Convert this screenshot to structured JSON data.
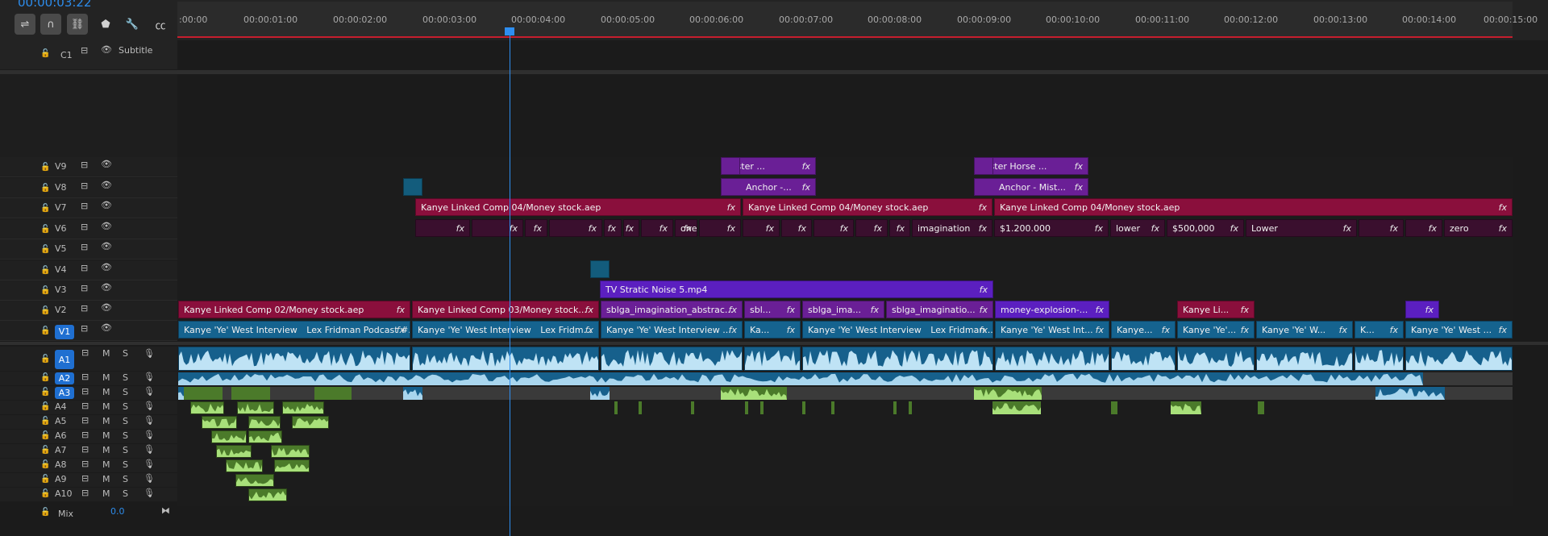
{
  "timecode": "00:00:03:22",
  "ruler_ticks": [
    ":00:00",
    "00:00:01:00",
    "00:00:02:00",
    "00:00:03:00",
    "00:00:04:00",
    "00:00:05:00",
    "00:00:06:00",
    "00:00:07:00",
    "00:00:08:00",
    "00:00:09:00",
    "00:00:10:00",
    "00:00:11:00",
    "00:00:12:00",
    "00:00:13:00",
    "00:00:14:00",
    "00:00:15:00"
  ],
  "caption_track": {
    "name": "C1",
    "label": "Subtitle"
  },
  "video_tracks": [
    "V9",
    "V8",
    "V7",
    "V6",
    "V5",
    "V4",
    "V3",
    "V2",
    "V1"
  ],
  "audio_tracks": [
    "A1",
    "A2",
    "A3",
    "A4",
    "A5",
    "A6",
    "A7",
    "A8",
    "A9",
    "A10"
  ],
  "mix": {
    "label": "Mix",
    "value": "0.0"
  },
  "audio_buttons": {
    "mute": "M",
    "solo": "S"
  },
  "fx": "fx",
  "clips": {
    "v9_a": "Mister ...",
    "v9_b": "Mister Horse ...",
    "v8_a": "Anchor -...",
    "v8_b": "Anchor - Mist...",
    "v7_a": "Kanye Linked Comp 04/Money stock.aep",
    "v7_b": "Kanye Linked Comp 04/Money stock.aep",
    "v7_c": "Kanye Linked Comp 04/Money stock.aep",
    "v6_one": "one",
    "v6_imagination": "imagination",
    "v6_1200000": "$1.200.000",
    "v6_lower1": "lower",
    "v6_500000": "$500,000",
    "v6_lower2": "Lower",
    "v6_zero": "zero",
    "v3_a": "TV Stratic Noise 5.mp4",
    "v2_a": "Kanye Linked Comp 02/Money stock.aep",
    "v2_b": "Kanye Linked Comp 03/Money stock...",
    "v2_c": "sblga_imagination_abstrac...",
    "v2_d": "sbl...",
    "v2_e": "sblga_ima...",
    "v2_f": "sblga_imaginatio...",
    "v2_g": "money-explosion-...",
    "v2_h": "Kanye Li...",
    "v1_a": "Kanye 'Ye' West Interview",
    "v1_a2": "Lex Fridman Podcast #...",
    "v1_b": "Kanye 'Ye' West Interview",
    "v1_b2": "Lex Fridm...",
    "v1_c": "Kanye 'Ye' West Interview ...",
    "v1_d": "Ka...",
    "v1_e": "Kanye 'Ye' West Interview",
    "v1_e2": "Lex Fridman...",
    "v1_f": "Kanye 'Ye' West Int...",
    "v1_g": "Kanye...",
    "v1_h": "Kanye 'Ye'...",
    "v1_i": "Kanye 'Ye' W...",
    "v1_j": "K...",
    "v1_k": "Kanye 'Ye' West ..."
  }
}
